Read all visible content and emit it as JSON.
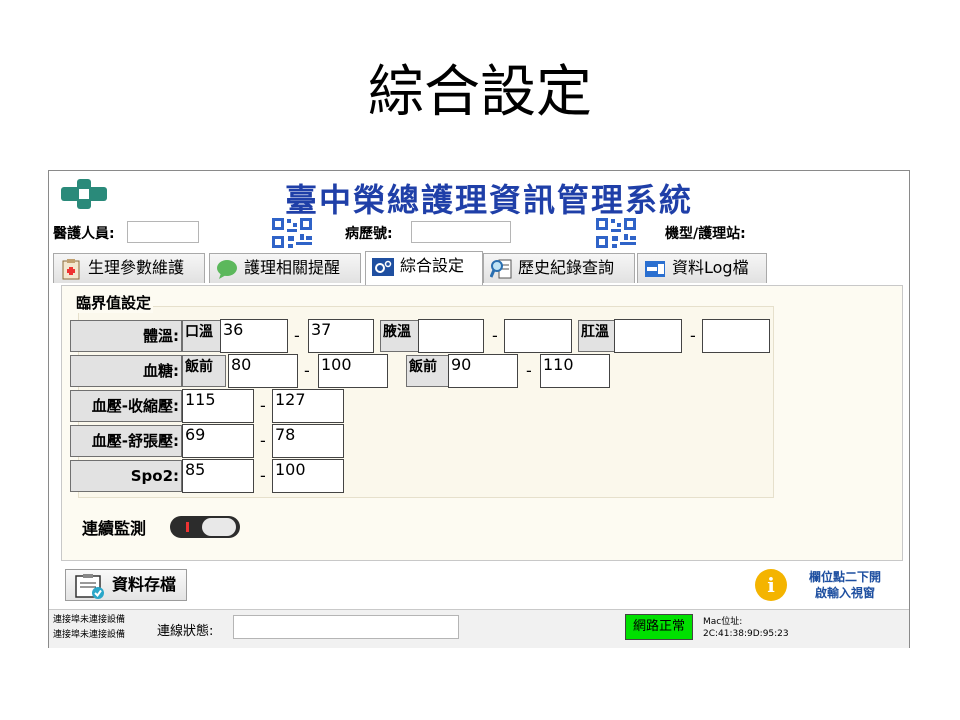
{
  "slide": {
    "title": "綜合設定"
  },
  "app": {
    "title": "臺中榮總護理資訊管理系統",
    "header": {
      "staff_label": "醫護人員:",
      "staff_value": "",
      "record_label": "病歷號:",
      "record_value": "",
      "station_label": "機型/護理站:"
    },
    "tabs": [
      {
        "label": "生理參數維護",
        "icon": "clipboard-icon"
      },
      {
        "label": "護理相關提醒",
        "icon": "chat-bubble-icon"
      },
      {
        "label": "綜合設定",
        "icon": "gears-icon"
      },
      {
        "label": "歷史紀錄查詢",
        "icon": "magnifier-document-icon"
      },
      {
        "label": "資料Log檔",
        "icon": "log-icon"
      }
    ],
    "active_tab": 2,
    "threshold": {
      "title": "臨界值設定",
      "temp": {
        "label": "體溫:",
        "oral_label": "口溫",
        "oral_min": "36",
        "oral_max": "37",
        "axillary_label": "腋溫",
        "axillary_min": "",
        "axillary_max": "",
        "rectal_label": "肛溫",
        "rectal_min": "",
        "rectal_max": ""
      },
      "sugar": {
        "label": "血糖:",
        "pre1_label": "飯前",
        "pre1_min": "80",
        "pre1_max": "100",
        "pre2_label": "飯前",
        "pre2_min": "90",
        "pre2_max": "110"
      },
      "systolic": {
        "label": "血壓-收縮壓:",
        "min": "115",
        "max": "127"
      },
      "diastolic": {
        "label": "血壓-舒張壓:",
        "min": "69",
        "max": "78"
      },
      "spo2": {
        "label": "Spo2:",
        "min": "85",
        "max": "100"
      },
      "dash": "-"
    },
    "monitor_label": "連續監測",
    "save_label": "資料存檔",
    "hint": {
      "icon_text": "i",
      "line1": "欄位點二下開",
      "line2": "啟輸入視窗"
    },
    "status": {
      "device_line1": "連接埠未連接設備",
      "device_line2": "連接埠未連接設備",
      "conn_label": "連線狀態:",
      "conn_value": "",
      "network": "網路正常",
      "mac_label": "Mac位址:",
      "mac_value": "2C:41:38:9D:95:23"
    }
  },
  "colors": {
    "title_blue": "#1f3fa8",
    "network_ok": "#00e000",
    "hint_blue": "#1e4fa0",
    "panel_bg": "#fdfbf2"
  }
}
